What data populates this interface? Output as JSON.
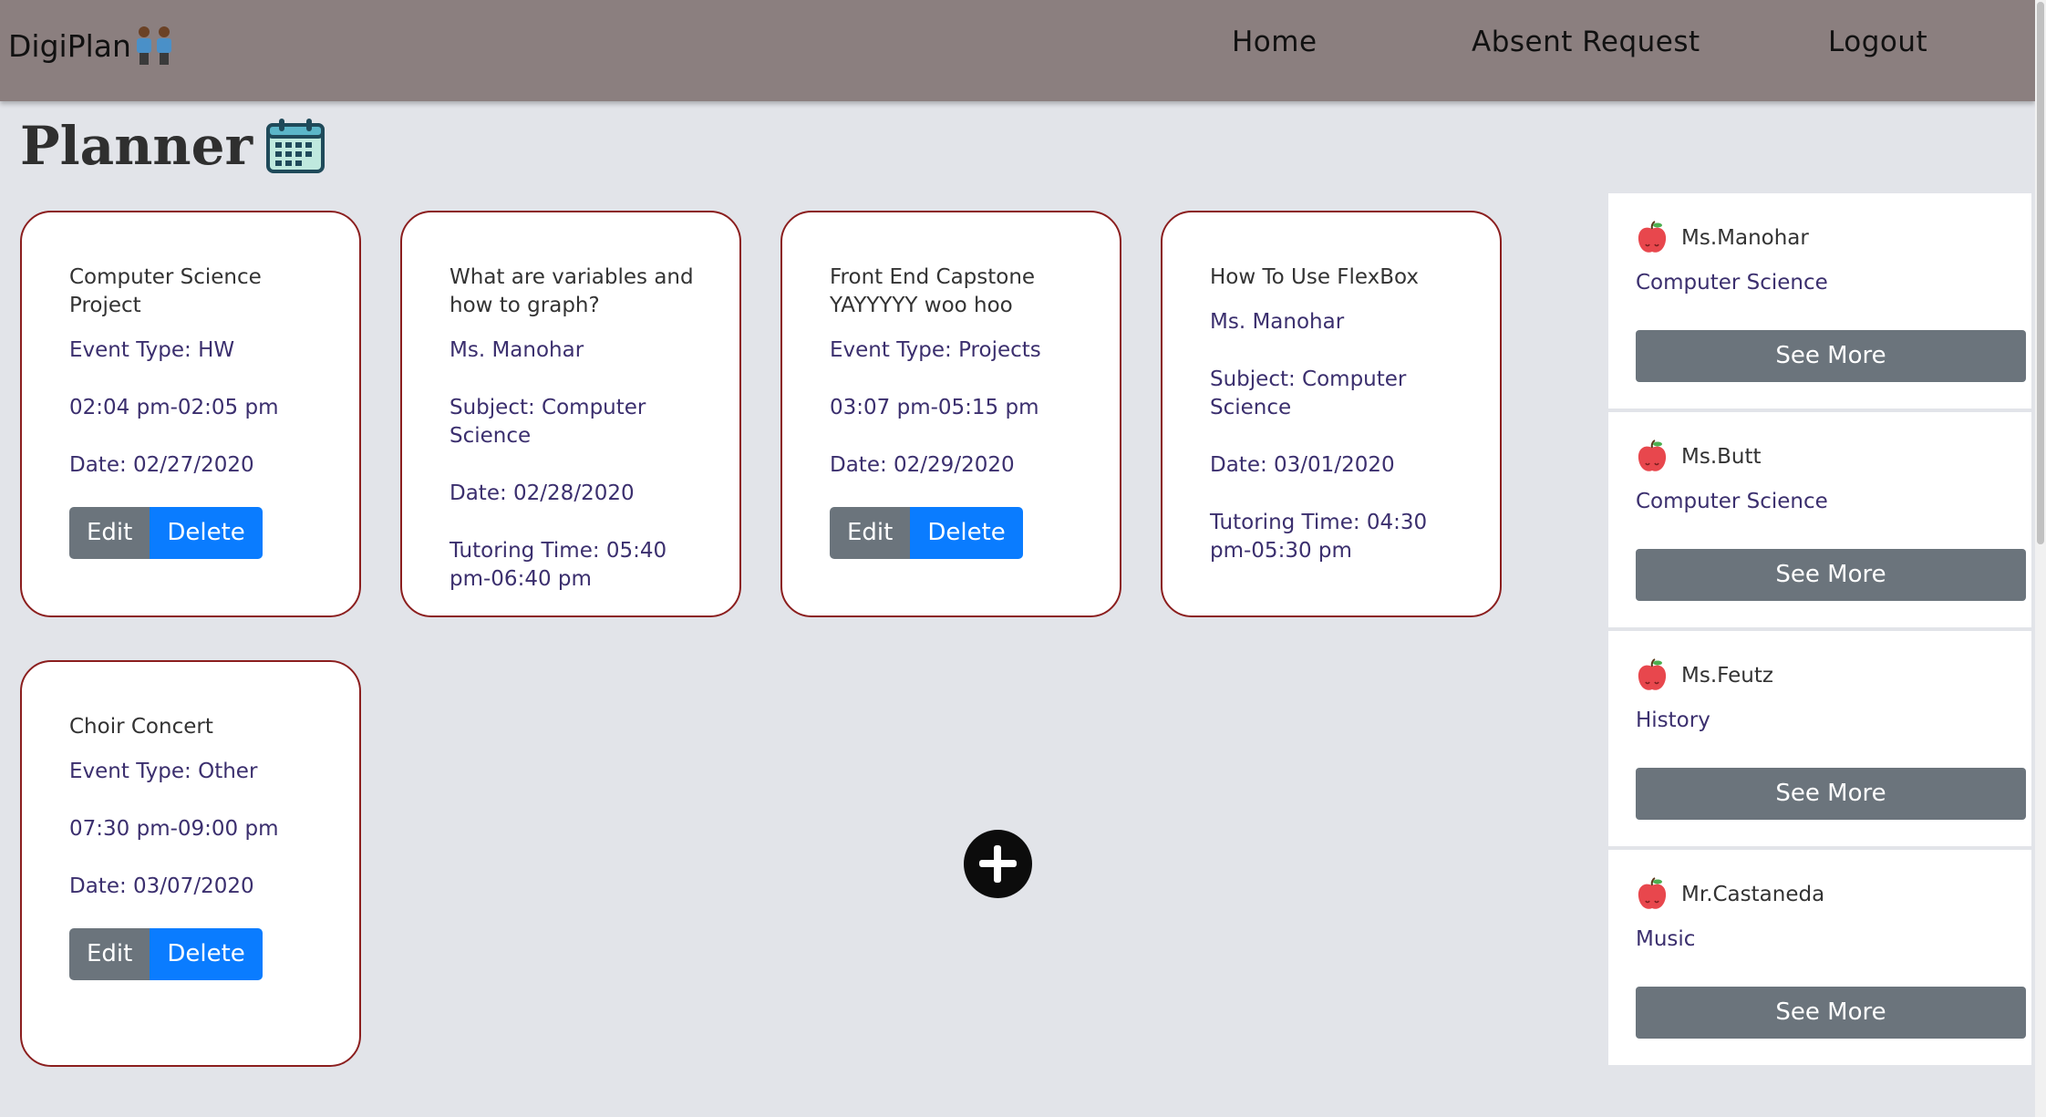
{
  "nav": {
    "brand": "DigiPlan",
    "links": [
      "Home",
      "Absent Request",
      "Logout"
    ]
  },
  "page": {
    "title": "Planner"
  },
  "events": [
    {
      "title": "Computer Science Project",
      "fields": [
        "Event Type: HW",
        "02:04 pm-02:05 pm",
        "Date: 02/27/2020"
      ],
      "edit": "Edit",
      "delete": "Delete"
    },
    {
      "title": "What are variables and how to graph?",
      "fields": [
        "Ms. Manohar",
        "Subject: Computer Science",
        "Date: 02/28/2020",
        "Tutoring Time: 05:40 pm-06:40 pm"
      ]
    },
    {
      "title": "Front End Capstone YAYYYYY woo hoo",
      "fields": [
        "Event Type: Projects",
        "03:07 pm-05:15 pm",
        "Date: 02/29/2020"
      ],
      "edit": "Edit",
      "delete": "Delete"
    },
    {
      "title": "How To Use FlexBox",
      "fields": [
        "Ms. Manohar",
        "Subject: Computer Science",
        "Date: 03/01/2020",
        "Tutoring Time: 04:30 pm-05:30 pm"
      ]
    },
    {
      "title": "Choir Concert",
      "fields": [
        "Event Type: Other",
        "07:30 pm-09:00 pm",
        "Date: 03/07/2020"
      ],
      "edit": "Edit",
      "delete": "Delete"
    }
  ],
  "teachers": [
    {
      "name": "Ms.Manohar",
      "subject": "Computer Science",
      "button": "See More"
    },
    {
      "name": "Ms.Butt",
      "subject": "Computer Science",
      "button": "See More"
    },
    {
      "name": "Ms.Feutz",
      "subject": "History",
      "button": "See More"
    },
    {
      "name": "Mr.Castaneda",
      "subject": "Music",
      "button": "See More"
    }
  ],
  "icons": {
    "brand": "students-icon",
    "title": "calendar-icon",
    "teacher": "apple-icon",
    "add": "add-icon"
  },
  "colors": {
    "navbar": "#8b7f7f",
    "card_border": "#8b1e1e",
    "edit_button": "#6b747c",
    "delete_button": "#0a7cff"
  }
}
